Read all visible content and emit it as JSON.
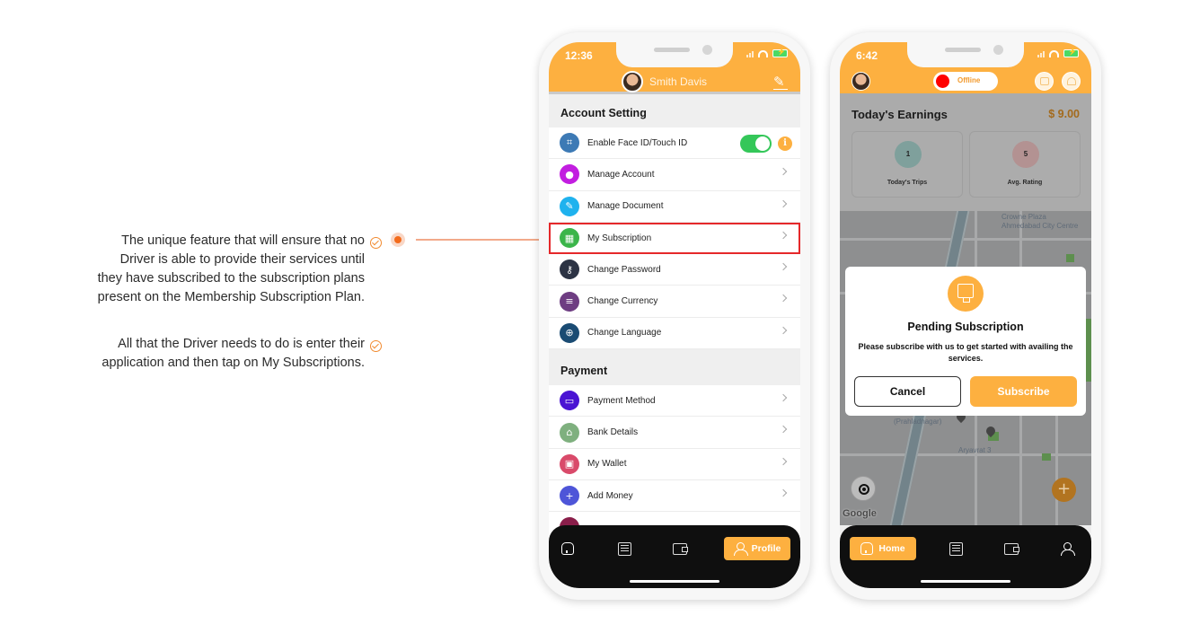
{
  "annotation": {
    "paragraphs": [
      "The unique feature that will ensure that no Driver is able to provide their services until they have subscribed to the subscription plans present on the Membership Subscription Plan.",
      "All that the Driver needs to do is enter their application and then tap on My Subscriptions."
    ],
    "accent_color": "#f36b1c"
  },
  "phone_profile": {
    "status_time": "12:36",
    "user_name": "Smith Davis",
    "sections": [
      {
        "title": "Account Setting",
        "items": [
          {
            "label": "Enable Face ID/Touch ID",
            "icon": "face-id-icon",
            "color": "#3d7ab5",
            "control": "toggle",
            "toggle_on": true
          },
          {
            "label": "Manage Account",
            "icon": "user-icon",
            "color": "#c21ee0"
          },
          {
            "label": "Manage Document",
            "icon": "document-icon",
            "color": "#1fb2ee"
          },
          {
            "label": "My Subscription",
            "icon": "subscription-icon",
            "color": "#3bb54a",
            "highlighted": true
          },
          {
            "label": "Change Password",
            "icon": "key-icon",
            "color": "#2c3344"
          },
          {
            "label": "Change Currency",
            "icon": "currency-icon",
            "color": "#6e3d82"
          },
          {
            "label": "Change Language",
            "icon": "globe-icon",
            "color": "#1a4b73"
          }
        ]
      },
      {
        "title": "Payment",
        "items": [
          {
            "label": "Payment Method",
            "icon": "card-icon",
            "color": "#4a14d3"
          },
          {
            "label": "Bank Details",
            "icon": "bank-icon",
            "color": "#7fb07f"
          },
          {
            "label": "My Wallet",
            "icon": "wallet-icon",
            "color": "#d94a6a"
          },
          {
            "label": "Add Money",
            "icon": "add-money-icon",
            "color": "#4e55d8"
          }
        ]
      }
    ],
    "tabs": [
      {
        "label": "Home",
        "icon": "home-icon",
        "active": false
      },
      {
        "label": "Trips",
        "icon": "list-icon",
        "active": false
      },
      {
        "label": "Wallet",
        "icon": "wallet-icon",
        "active": false
      },
      {
        "label": "Profile",
        "icon": "user-icon",
        "active": true
      }
    ]
  },
  "phone_home": {
    "status_time": "6:42",
    "availability": "Offline",
    "earnings_title": "Today's Earnings",
    "earnings_value": "$ 9.00",
    "stats": [
      {
        "label": "Today's Trips",
        "value": "1"
      },
      {
        "label": "Avg. Rating",
        "value": "5"
      }
    ],
    "map_labels": [
      "Crowne Plaza",
      "Ahmedabad City Centre",
      "(Prahladnagar)",
      "Aryavrat 3"
    ],
    "map_attribution": "Google",
    "modal": {
      "title": "Pending Subscription",
      "message": "Please subscribe with us to get started with availing the services.",
      "cancel_label": "Cancel",
      "subscribe_label": "Subscribe"
    },
    "tabs": [
      {
        "label": "Home",
        "icon": "home-icon",
        "active": true
      },
      {
        "label": "Trips",
        "icon": "list-icon",
        "active": false
      },
      {
        "label": "Wallet",
        "icon": "wallet-icon",
        "active": false
      },
      {
        "label": "Profile",
        "icon": "user-icon",
        "active": false
      }
    ]
  },
  "colors": {
    "brand": "#fdb040",
    "highlight_border": "#e5282a",
    "toggle_on": "#34c759"
  }
}
